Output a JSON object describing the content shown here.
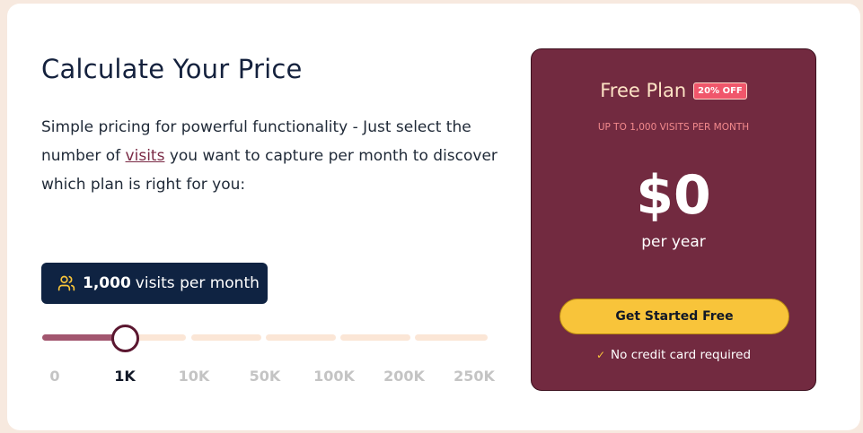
{
  "calculator": {
    "title": "Calculate Your Price",
    "description_before_link": "Simple pricing for powerful functionality - Just select the number of ",
    "description_link": "visits",
    "description_after_link": " you want to capture per month to discover which plan is right for you:"
  },
  "visits_badge": {
    "icon": "users-icon",
    "count": "1,000",
    "suffix": "visits per month"
  },
  "slider": {
    "ticks": [
      "0",
      "1K",
      "10K",
      "50K",
      "100K",
      "200K",
      "250K"
    ],
    "selected": "1K",
    "colors": {
      "fill": "#a2566f",
      "track": "#fbe6d6",
      "thumb_border": "#5b1730"
    }
  },
  "plan": {
    "name": "Free Plan",
    "discount_badge": "20% OFF",
    "limit": "UP TO 1,000 VISITS PER MONTH",
    "price": "$0",
    "period": "per year",
    "cta": "Get Started Free",
    "note": "No credit card required",
    "note_icon": "check-icon",
    "colors": {
      "background": "#722a40",
      "button": "#f8c43a",
      "badge": "#f0566b"
    }
  }
}
